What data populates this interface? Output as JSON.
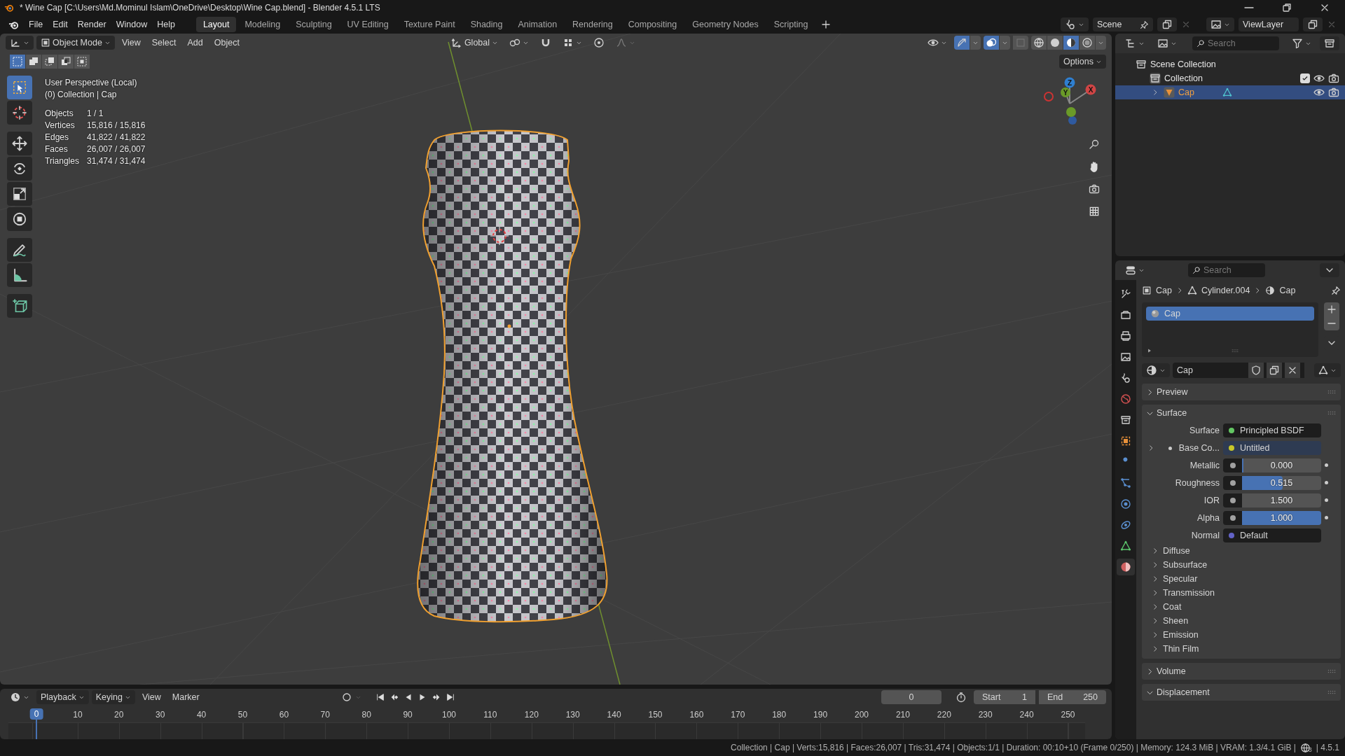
{
  "window": {
    "title": "* Wine Cap [C:\\Users\\Md.Mominul Islam\\OneDrive\\Desktop\\Wine Cap.blend] - Blender 4.5.1 LTS"
  },
  "topbar": {
    "menus": [
      "File",
      "Edit",
      "Render",
      "Window",
      "Help"
    ],
    "workspaces": [
      {
        "label": "Layout",
        "selected": true
      },
      {
        "label": "Modeling",
        "selected": false
      },
      {
        "label": "Sculpting",
        "selected": false
      },
      {
        "label": "UV Editing",
        "selected": false
      },
      {
        "label": "Texture Paint",
        "selected": false
      },
      {
        "label": "Shading",
        "selected": false
      },
      {
        "label": "Animation",
        "selected": false
      },
      {
        "label": "Rendering",
        "selected": false
      },
      {
        "label": "Compositing",
        "selected": false
      },
      {
        "label": "Geometry Nodes",
        "selected": false
      },
      {
        "label": "Scripting",
        "selected": false
      }
    ],
    "scene": "Scene",
    "view_layer": "ViewLayer"
  },
  "viewport": {
    "mode": "Object Mode",
    "menus": [
      "View",
      "Select",
      "Add",
      "Object"
    ],
    "orientation": "Global",
    "toggles": [
      {
        "kind": "gizmo",
        "on": true
      },
      {
        "kind": "overlay",
        "on": true
      },
      {
        "kind": "xray",
        "on": false
      }
    ],
    "shading_modes": [
      {
        "kind": "wireframe",
        "selected": false
      },
      {
        "kind": "solid",
        "selected": false
      },
      {
        "kind": "material",
        "selected": true
      },
      {
        "kind": "rendered",
        "selected": false
      }
    ],
    "options": "Options",
    "select_modes": [
      {
        "kind": "new",
        "selected": true
      },
      {
        "kind": "extend",
        "selected": false
      },
      {
        "kind": "subtract",
        "selected": false
      },
      {
        "kind": "invert",
        "selected": false
      },
      {
        "kind": "intersect",
        "selected": false
      }
    ],
    "tools": [
      {
        "kind": "select",
        "selected": true
      },
      {
        "kind": "cursor",
        "selected": false
      },
      {
        "kind": "move",
        "selected": false
      },
      {
        "kind": "rotate",
        "selected": false
      },
      {
        "kind": "scale",
        "selected": false
      },
      {
        "kind": "transform",
        "selected": false
      },
      {
        "kind": "annotate",
        "selected": false
      },
      {
        "kind": "measure",
        "selected": false
      },
      {
        "kind": "add_cube",
        "selected": false
      }
    ],
    "info": {
      "perspective": "User Perspective (Local)",
      "context": "(0) Collection | Cap"
    },
    "stats": [
      {
        "label": "Objects",
        "value": "1 / 1"
      },
      {
        "label": "Vertices",
        "value": "15,816 / 15,816"
      },
      {
        "label": "Edges",
        "value": "41,822 / 41,822"
      },
      {
        "label": "Faces",
        "value": "26,007 / 26,007"
      },
      {
        "label": "Triangles",
        "value": "31,474 / 31,474"
      }
    ],
    "gizmo_axes": [
      "Z",
      "Y",
      "X"
    ]
  },
  "timeline": {
    "menus": [
      {
        "label": "Playback",
        "kind": "dropdown"
      },
      {
        "label": "Keying",
        "kind": "dropdown"
      },
      {
        "label": "View",
        "kind": "menu"
      },
      {
        "label": "Marker",
        "kind": "menu"
      }
    ],
    "current_frame": "0",
    "start_label": "Start",
    "start": "1",
    "end_label": "End",
    "end": "250",
    "playhead": "0",
    "ticks": [
      "10",
      "20",
      "30",
      "40",
      "50",
      "60",
      "70",
      "80",
      "90",
      "100",
      "110",
      "120",
      "130",
      "140",
      "150",
      "160",
      "170",
      "180",
      "190",
      "200",
      "210",
      "220",
      "230",
      "240",
      "250"
    ]
  },
  "outliner": {
    "search": {
      "placeholder": "Search"
    },
    "tree": [
      {
        "label": "Scene Collection",
        "kind": "scene_collection",
        "selected": false,
        "children": [
          {
            "label": "Collection",
            "kind": "collection",
            "selected": false,
            "checked": true,
            "children": [
              {
                "label": "Cap",
                "kind": "object",
                "selected": true,
                "expanded": false
              }
            ]
          }
        ]
      }
    ]
  },
  "properties": {
    "search": {
      "placeholder": "Search"
    },
    "tabs": [
      {
        "kind": "tool",
        "selected": false
      },
      {
        "kind": "render",
        "selected": false
      },
      {
        "kind": "output",
        "selected": false
      },
      {
        "kind": "view_layer",
        "selected": false
      },
      {
        "kind": "scene",
        "selected": false
      },
      {
        "kind": "world",
        "selected": false
      },
      {
        "kind": "collection",
        "selected": false
      },
      {
        "kind": "object",
        "selected": false
      },
      {
        "kind": "modifiers",
        "selected": false
      },
      {
        "kind": "particles",
        "selected": false
      },
      {
        "kind": "physics",
        "selected": false
      },
      {
        "kind": "constraints",
        "selected": false
      },
      {
        "kind": "data",
        "selected": false
      },
      {
        "kind": "material",
        "selected": true
      }
    ],
    "breadcrumb": [
      {
        "kind": "object",
        "label": "Cap"
      },
      {
        "kind": "mesh",
        "label": "Cylinder.004"
      },
      {
        "kind": "material",
        "label": "Cap"
      }
    ],
    "material_slots": [
      {
        "label": "Cap",
        "selected": true
      }
    ],
    "material_name": "Cap",
    "panels": [
      {
        "label": "Preview",
        "expanded": false
      },
      {
        "label": "Surface",
        "expanded": true,
        "fields": [
          {
            "kind": "shader",
            "label": "Surface",
            "value": "Principled BSDF",
            "color": "#63c763"
          },
          {
            "kind": "texture",
            "label": "Base Co...",
            "value": "Untitled",
            "color": "#c7c729",
            "expanded": false
          },
          {
            "kind": "slider",
            "label": "Metallic",
            "value": "0.000",
            "level": 0,
            "color": "#a1a1a1"
          },
          {
            "kind": "slider",
            "label": "Roughness",
            "value": "0.515",
            "level": 0.515,
            "color": "#a1a1a1"
          },
          {
            "kind": "number",
            "label": "IOR",
            "value": "1.500",
            "color": "#a1a1a1"
          },
          {
            "kind": "slider",
            "label": "Alpha",
            "value": "1.000",
            "level": 1,
            "color": "#a1a1a1"
          },
          {
            "kind": "vector",
            "label": "Normal",
            "value": "Default",
            "color": "#6363c7"
          }
        ],
        "subpanels": [
          {
            "label": "Diffuse",
            "expanded": false
          },
          {
            "label": "Subsurface",
            "expanded": false
          },
          {
            "label": "Specular",
            "expanded": false
          },
          {
            "label": "Transmission",
            "expanded": false
          },
          {
            "label": "Coat",
            "expanded": false
          },
          {
            "label": "Sheen",
            "expanded": false
          },
          {
            "label": "Emission",
            "expanded": false
          },
          {
            "label": "Thin Film",
            "expanded": false
          }
        ]
      },
      {
        "label": "Volume",
        "expanded": false
      },
      {
        "label": "Displacement",
        "expanded": true
      }
    ]
  },
  "status_bar": {
    "text": "Collection | Cap | Verts:15,816 | Faces:26,007 | Tris:31,474 | Objects:1/1 | Duration: 00:10+10 (Frame 0/250) | Memory: 124.3 MiB | VRAM: 1.3/4.1 GiB |",
    "network_badge": "3",
    "version": "| 4.5.1"
  }
}
